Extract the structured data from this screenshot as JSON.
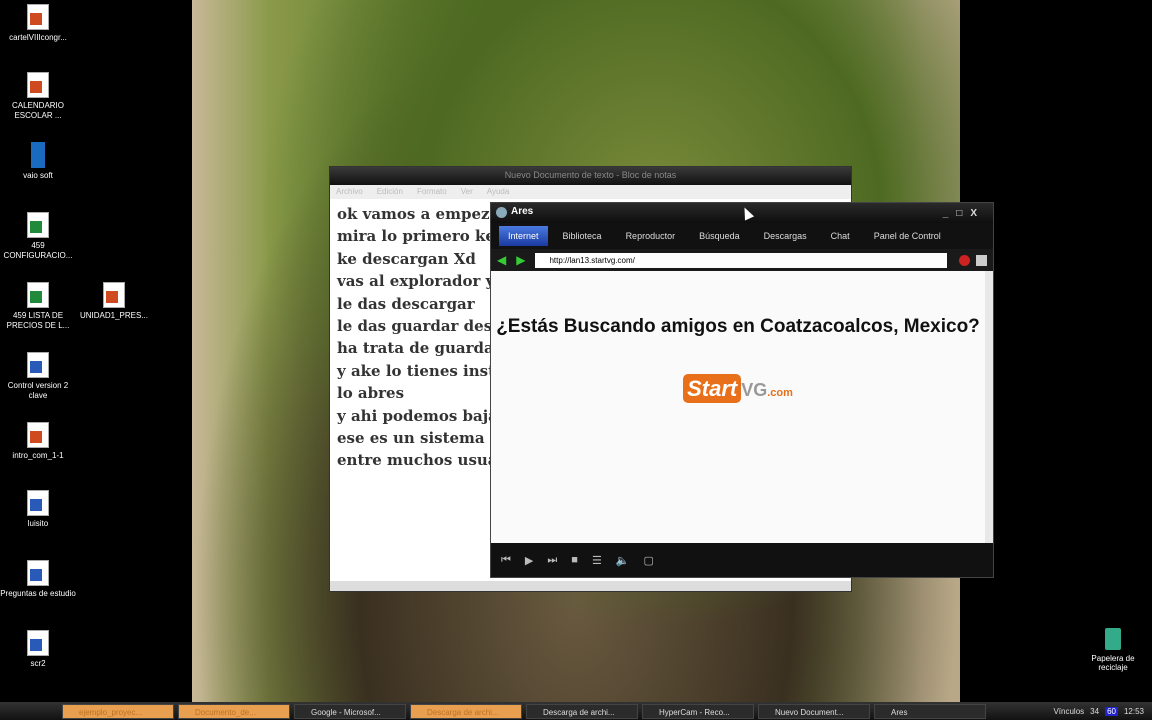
{
  "desktop_icons": [
    {
      "label": "cartelVIIIcongr...",
      "type": "p"
    },
    {
      "label": "CALENDARIO ESCOLAR ...",
      "type": "p"
    },
    {
      "label": "vaio soft",
      "type": "b"
    },
    {
      "label": "459 CONFIGURACIO...",
      "type": "x"
    },
    {
      "label": "459 LISTA DE PRECIOS DE L...",
      "type": "x"
    },
    {
      "label": "UNIDAD1_PRES...",
      "type": "p"
    },
    {
      "label": "Control version 2 clave",
      "type": "w"
    },
    {
      "label": "intro_com_1-1",
      "type": "p"
    },
    {
      "label": "luisito",
      "type": "w"
    },
    {
      "label": "Preguntas de estudio",
      "type": "w"
    },
    {
      "label": "scr2",
      "type": "w"
    }
  ],
  "recycle_bin": "Papelera de reciclaje",
  "notepad": {
    "title": "Nuevo Documento de texto - Bloc de notas",
    "menu": [
      "Archivo",
      "Edición",
      "Formato",
      "Ver",
      "Ayuda"
    ],
    "lines": [
      "ok vamos a empeza",
      "mira lo primero ke v",
      "ke descargan Xd",
      "vas al explorador y a",
      "le das descargar",
      "le das guardar desp",
      "ha trata de guardar",
      "y ake lo tienes insta",
      "lo abres",
      "y ahi podemos baja",
      "ese es un sistema ke",
      "entre muchos usuar"
    ]
  },
  "ares": {
    "title": "Ares",
    "tabs": [
      "Internet",
      "Biblioteca",
      "Reproductor",
      "Búsqueda",
      "Descargas",
      "Chat",
      "Panel de Control"
    ],
    "url": "http://lan13.startvg.com/",
    "headline": "¿Estás Buscando amigos en Coatzacoalcos, Mexico?",
    "brand": {
      "start": "Start",
      "vg": "VG",
      ".com": ".com"
    }
  },
  "taskbar": {
    "items": [
      "ejemplo_proyec...",
      "Documento_de...",
      "Google - Microsof...",
      "Descarga de archi...",
      "Descarga de archi...",
      "HyperCam - Reco...",
      "Nuevo Document...",
      "Ares"
    ],
    "tray": {
      "links": "Vínculos",
      "num1": "34",
      "num2": "60",
      "clock": "12:53"
    }
  }
}
